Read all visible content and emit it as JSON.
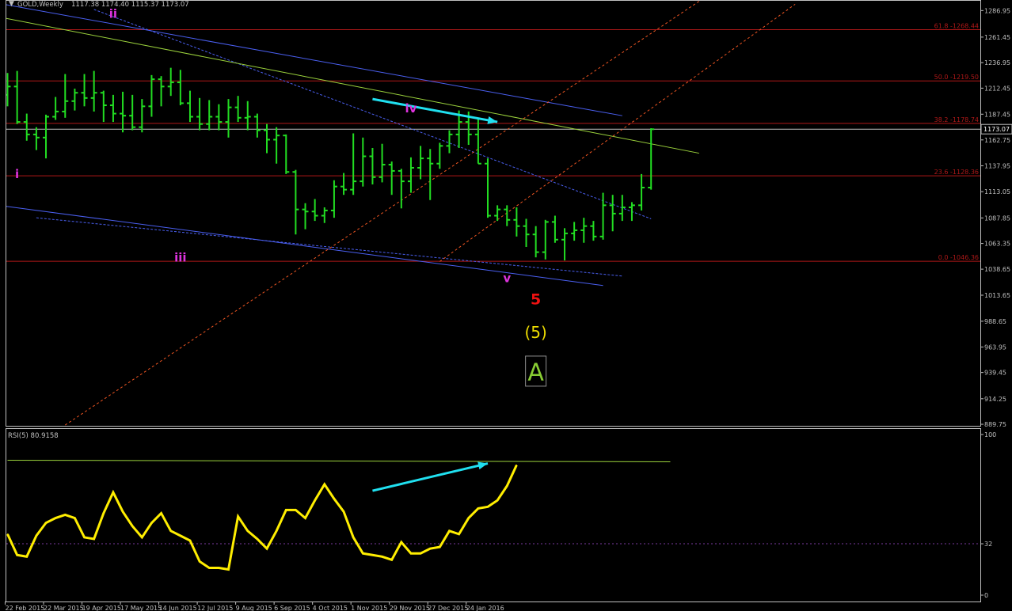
{
  "header": {
    "symbol": "GOLD,Weekly",
    "ohlc": "1117.38 1174.40 1115.37 1173.07",
    "menu_icon": "triangle-down-icon"
  },
  "rsi_header": {
    "label": "RSI(5) 80.9158"
  },
  "colors": {
    "background": "#000000",
    "frame": "#c0c0c0",
    "bar": "#22dd22",
    "fib": "#b01818",
    "channel": "#4a5ff0",
    "signal_arrow": "#20e0f0",
    "wave_minor": "#dd33dd",
    "wave_5": "#ee1111",
    "wave_paren": "#eedd00",
    "wave_A": "#88cc33",
    "rsi_line": "#ffee00",
    "green_line": "#9bd23c",
    "orange_channel": "#ee5522",
    "label_text": "#c0c0c0"
  },
  "chart_data": [
    {
      "type": "ohlc",
      "title": "GOLD,Weekly",
      "ylim": [
        889.8,
        1291
      ],
      "y_ticks": [
        "1286.95",
        "1261.45",
        "1236.95",
        "1212.45",
        "1187.45",
        "1162.75",
        "1137.95",
        "1113.05",
        "1087.85",
        "1063.35",
        "1038.65",
        "1013.65",
        "988.65",
        "963.95",
        "939.45",
        "914.25",
        "889.75"
      ],
      "last_price": "1173.07",
      "x_labels": [
        "22 Feb 2015",
        "22 Mar 2015",
        "19 Apr 2015",
        "17 May 2015",
        "14 Jun 2015",
        "12 Jul 2015",
        "9 Aug 2015",
        "6 Sep 2015",
        "4 Oct 2015",
        "1 Nov 2015",
        "29 Nov 2015",
        "27 Dec 2015",
        "24 Jan 2016"
      ],
      "bars": [
        [
          1206,
          1227,
          1195,
          1214
        ],
        [
          1214,
          1229,
          1178,
          1180
        ],
        [
          1180,
          1188,
          1162,
          1168
        ],
        [
          1168,
          1175,
          1153,
          1165
        ],
        [
          1165,
          1187,
          1145,
          1185
        ],
        [
          1185,
          1204,
          1182,
          1190
        ],
        [
          1190,
          1226,
          1184,
          1200
        ],
        [
          1200,
          1212,
          1191,
          1208
        ],
        [
          1208,
          1226,
          1195,
          1203
        ],
        [
          1203,
          1229,
          1190,
          1208
        ],
        [
          1208,
          1210,
          1180,
          1196
        ],
        [
          1196,
          1206,
          1180,
          1188
        ],
        [
          1188,
          1209,
          1170,
          1186
        ],
        [
          1186,
          1206,
          1172,
          1175
        ],
        [
          1175,
          1202,
          1170,
          1195
        ],
        [
          1195,
          1225,
          1185,
          1221
        ],
        [
          1221,
          1224,
          1195,
          1214
        ],
        [
          1214,
          1232,
          1205,
          1218
        ],
        [
          1218,
          1230,
          1196,
          1198
        ],
        [
          1198,
          1210,
          1180,
          1185
        ],
        [
          1185,
          1203,
          1172,
          1178
        ],
        [
          1178,
          1201,
          1172,
          1185
        ],
        [
          1185,
          1197,
          1172,
          1180
        ],
        [
          1180,
          1202,
          1165,
          1194
        ],
        [
          1194,
          1205,
          1180,
          1184
        ],
        [
          1184,
          1200,
          1172,
          1185
        ],
        [
          1185,
          1188,
          1165,
          1172
        ],
        [
          1172,
          1178,
          1150,
          1163
        ],
        [
          1163,
          1175,
          1140,
          1167
        ],
        [
          1167,
          1168,
          1130,
          1132
        ],
        [
          1132,
          1134,
          1072,
          1096
        ],
        [
          1096,
          1102,
          1077,
          1094
        ],
        [
          1094,
          1106,
          1085,
          1090
        ],
        [
          1090,
          1098,
          1083,
          1095
        ],
        [
          1095,
          1124,
          1088,
          1118
        ],
        [
          1118,
          1131,
          1110,
          1115
        ],
        [
          1115,
          1169,
          1110,
          1123
        ],
        [
          1123,
          1165,
          1118,
          1147
        ],
        [
          1147,
          1155,
          1120,
          1127
        ],
        [
          1127,
          1159,
          1122,
          1139
        ],
        [
          1139,
          1142,
          1110,
          1133
        ],
        [
          1133,
          1135,
          1097,
          1123
        ],
        [
          1123,
          1146,
          1112,
          1136
        ],
        [
          1136,
          1157,
          1125,
          1145
        ],
        [
          1145,
          1154,
          1105,
          1140
        ],
        [
          1140,
          1160,
          1135,
          1157
        ],
        [
          1157,
          1172,
          1150,
          1168
        ],
        [
          1168,
          1191,
          1155,
          1180
        ],
        [
          1180,
          1190,
          1158,
          1168
        ],
        [
          1168,
          1184,
          1140,
          1140
        ],
        [
          1140,
          1145,
          1088,
          1090
        ],
        [
          1090,
          1100,
          1085,
          1096
        ],
        [
          1096,
          1100,
          1080,
          1086
        ],
        [
          1086,
          1098,
          1070,
          1080
        ],
        [
          1080,
          1087,
          1060,
          1072
        ],
        [
          1072,
          1080,
          1050,
          1055
        ],
        [
          1055,
          1086,
          1048,
          1084
        ],
        [
          1084,
          1090,
          1064,
          1067
        ],
        [
          1067,
          1078,
          1047,
          1073
        ],
        [
          1073,
          1084,
          1066,
          1076
        ],
        [
          1076,
          1088,
          1064,
          1080
        ],
        [
          1080,
          1085,
          1066,
          1070
        ],
        [
          1070,
          1112,
          1067,
          1100
        ],
        [
          1100,
          1110,
          1075,
          1092
        ],
        [
          1092,
          1110,
          1085,
          1098
        ],
        [
          1098,
          1103,
          1085,
          1100
        ],
        [
          1100,
          1130,
          1095,
          1117
        ],
        [
          1117,
          1174,
          1115,
          1173
        ]
      ],
      "fib_levels": [
        {
          "label": "61.8 -1268.44",
          "value": 1268.6
        },
        {
          "label": "50.0 -1219.50",
          "value": 1219.4
        },
        {
          "label": "38.2 -1178.74",
          "value": 1178.6
        },
        {
          "label": "23.6 -1128.36",
          "value": 1128.3
        },
        {
          "label": "0.0 -1046.36",
          "value": 1046.2
        }
      ],
      "wave_labels": [
        {
          "text": "i",
          "bar": 1,
          "price": 1130
        },
        {
          "text": "ii",
          "bar": 11,
          "price": 1284
        },
        {
          "text": "iii",
          "bar": 18,
          "price": 1050
        },
        {
          "text": "iv",
          "bar": 42,
          "price": 1193
        },
        {
          "text": "v",
          "bar": 52,
          "price": 1030
        },
        {
          "text": "5",
          "bar": 55,
          "price": 1010
        },
        {
          "text": "(5)",
          "bar": 55,
          "price": 978
        },
        {
          "text": "A",
          "bar": 55,
          "price": 940
        }
      ],
      "trendlines": [
        {
          "kind": "channel",
          "from": [
            -1,
            1294
          ],
          "to": [
            64,
            1186
          ]
        },
        {
          "kind": "channel",
          "from": [
            -1,
            1100
          ],
          "to": [
            62,
            1023
          ]
        },
        {
          "kind": "channel-dashed",
          "from": [
            3,
            1088
          ],
          "to": [
            64,
            1032
          ]
        },
        {
          "kind": "channel-dashed",
          "from": [
            9,
            1288
          ],
          "to": [
            67,
            1087
          ]
        },
        {
          "kind": "green",
          "from": [
            -1,
            1281
          ],
          "to": [
            72,
            1150
          ]
        },
        {
          "kind": "orange-dashed",
          "from": [
            6,
            889
          ],
          "to": [
            73,
            1302
          ]
        },
        {
          "kind": "orange-dashed",
          "from": [
            45,
            1046
          ],
          "to": [
            82,
            1293
          ]
        }
      ],
      "arrow": {
        "from": [
          38,
          1202
        ],
        "to": [
          51,
          1180
        ]
      }
    },
    {
      "type": "line",
      "title": "RSI(5) 80.9158",
      "ylim": [
        0,
        100
      ],
      "y_ticks": [
        "100",
        "32",
        "0"
      ],
      "levels": [
        32
      ],
      "values": [
        38,
        25,
        24,
        37,
        45,
        48,
        50,
        48,
        36,
        35,
        51,
        64,
        52,
        43,
        36,
        45,
        51,
        40,
        37,
        34,
        21,
        17,
        17,
        16,
        49,
        40,
        35,
        29,
        40,
        53,
        53,
        48,
        59,
        69,
        60,
        52,
        36,
        26,
        25,
        24,
        22,
        33,
        26,
        26,
        29,
        30,
        40,
        38,
        48,
        54,
        55,
        59,
        68,
        81
      ],
      "trendline": {
        "from": [
          0,
          84
        ],
        "to": [
          69,
          83
        ]
      },
      "arrow": {
        "from": [
          38,
          65
        ],
        "to": [
          50,
          82
        ]
      }
    }
  ]
}
